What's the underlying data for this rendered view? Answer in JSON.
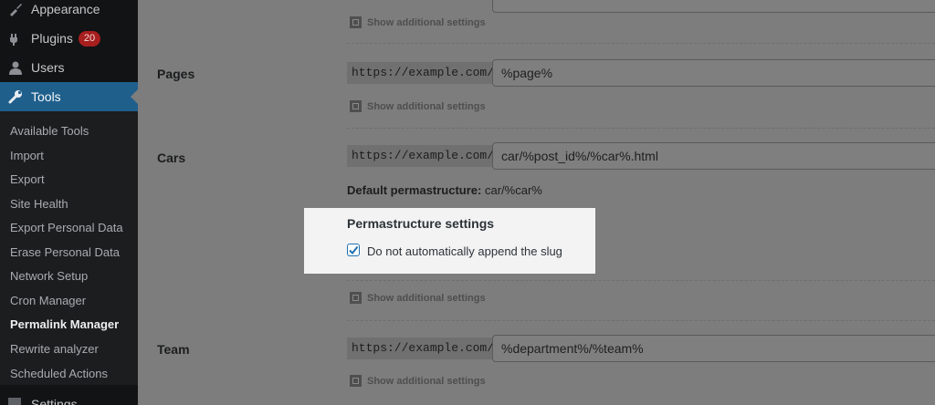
{
  "sidebar": {
    "items": [
      {
        "label": "Appearance",
        "icon": "paintbrush-icon"
      },
      {
        "label": "Plugins",
        "icon": "plug-icon",
        "badge": "20"
      },
      {
        "label": "Users",
        "icon": "user-icon"
      },
      {
        "label": "Tools",
        "icon": "wrench-icon",
        "active": true
      }
    ],
    "submenu": [
      "Available Tools",
      "Import",
      "Export",
      "Site Health",
      "Export Personal Data",
      "Erase Personal Data",
      "Network Setup",
      "Cron Manager",
      "Permalink Manager",
      "Rewrite analyzer",
      "Scheduled Actions"
    ],
    "current_submenu": "Permalink Manager",
    "settings_label": "Settings"
  },
  "main": {
    "base_url": "https://example.com/",
    "show_additional": "Show additional settings",
    "rows": [
      {
        "label": "Pages",
        "value": "%page%"
      },
      {
        "label": "Cars",
        "value": "car/%post_id%/%car%.html",
        "default_label": "Default permastructure:",
        "default_value": "car/%car%"
      },
      {
        "label": "Team",
        "value": "%department%/%team%"
      }
    ],
    "permastructure_panel": {
      "title": "Permastructure settings",
      "checkbox_label": "Do not automatically append the slug",
      "checked": true
    }
  },
  "colors": {
    "accent": "#2271b1",
    "active_menu": "#1f5f8c",
    "badge": "#a61e1e"
  }
}
